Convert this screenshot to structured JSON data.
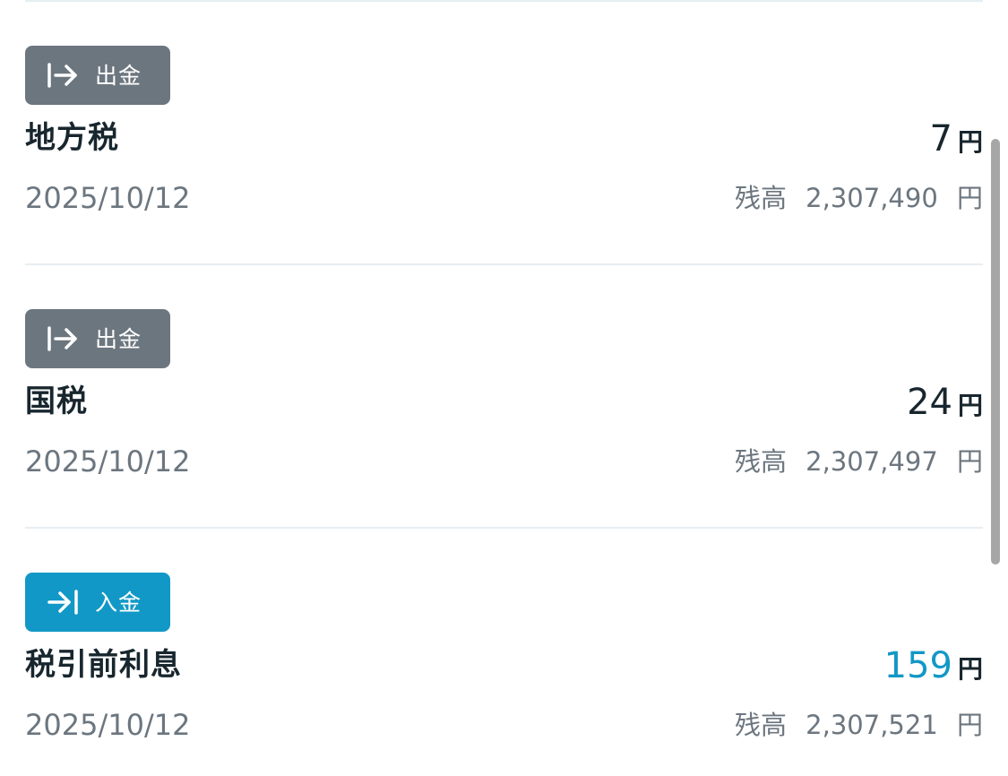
{
  "transactions": [
    {
      "type_label": "出金",
      "type_icon": "arrow-out-icon",
      "title": "地方税",
      "amount": "7",
      "currency": "円",
      "date": "2025/10/12",
      "balance_label": "残高",
      "balance_value": "2,307,490",
      "balance_currency": "円"
    },
    {
      "type_label": "出金",
      "type_icon": "arrow-out-icon",
      "title": "国税",
      "amount": "24",
      "currency": "円",
      "date": "2025/10/12",
      "balance_label": "残高",
      "balance_value": "2,307,497",
      "balance_currency": "円"
    },
    {
      "type_label": "入金",
      "type_icon": "arrow-in-icon",
      "title": "税引前利息",
      "amount": "159",
      "currency": "円",
      "date": "2025/10/12",
      "balance_label": "残高",
      "balance_value": "2,307,521",
      "balance_currency": "円"
    }
  ],
  "colors": {
    "withdrawal_badge": "#6c767f",
    "deposit_badge": "#1298c6",
    "income_amount": "#1298c6",
    "text_primary": "#18262e",
    "text_secondary": "#6c767f",
    "divider": "#e6eef2"
  }
}
